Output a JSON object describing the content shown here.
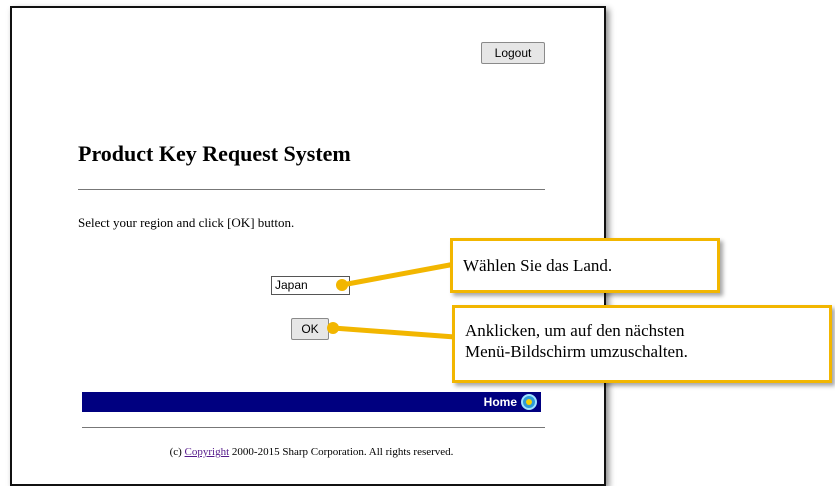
{
  "header": {
    "logout_label": "Logout"
  },
  "main": {
    "title": "Product Key Request System",
    "instruction": "Select your region and click [OK] button.",
    "region_select": {
      "selected": "Japan"
    },
    "ok_label": "OK"
  },
  "navbar": {
    "home_label": "Home",
    "home_icon": "home-globe-icon"
  },
  "footer": {
    "prefix": "(c) ",
    "link_text": "Copyright",
    "suffix": " 2000-2015 Sharp Corporation. All rights reserved."
  },
  "callouts": [
    {
      "text": "Wählen Sie das Land."
    },
    {
      "line1": "Anklicken, um auf den nächsten",
      "line2": "Menü-Bildschirm umzuschalten."
    }
  ],
  "colors": {
    "callout_accent": "#f2b600",
    "navbar": "#000080",
    "link_visited": "#551a8b"
  }
}
